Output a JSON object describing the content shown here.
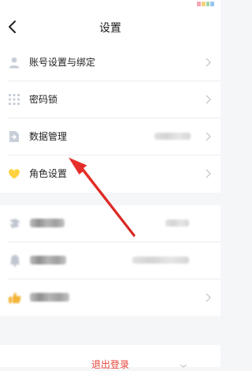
{
  "header": {
    "title": "设置",
    "back_icon": "chevron-left-icon"
  },
  "settings_group_1": [
    {
      "label": "账号设置与绑定",
      "icon": "user-icon",
      "icon_color": "#c9cfd8"
    },
    {
      "label": "密码锁",
      "icon": "keypad-dots-icon",
      "icon_color": "#c9cfd8"
    },
    {
      "label": "数据管理",
      "icon": "document-arrow-icon",
      "icon_color": "#c9cfd8"
    },
    {
      "label": "角色设置",
      "icon": "heart-icon",
      "icon_color": "#ffd23f"
    }
  ],
  "footer": {
    "logout_label": "退出登录"
  },
  "colors": {
    "accent_red": "#e8453c",
    "background": "#f5f6f8",
    "annotation_arrow": "#e8302c"
  }
}
